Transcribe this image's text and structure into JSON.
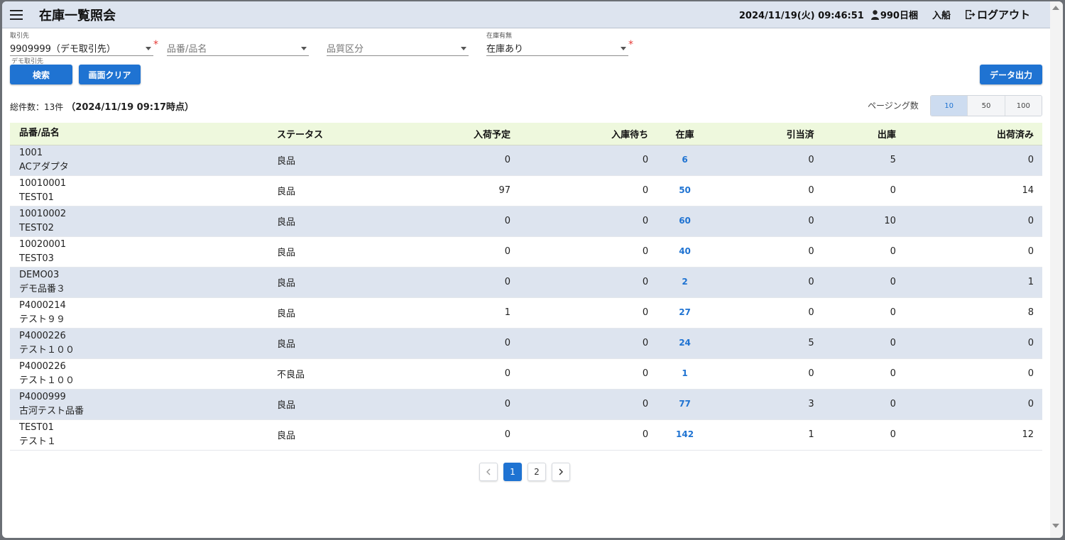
{
  "header": {
    "title": "在庫一覧照会",
    "datetime": "2024/11/19(火) 09:46:51",
    "user": "990日梱",
    "nyusen": "入船",
    "logout": "ログアウト"
  },
  "filters": {
    "torihikisaki": {
      "label": "取引先",
      "value": "9909999（デモ取引先）",
      "helper": "デモ取引先"
    },
    "hinban": {
      "placeholder": "品番/品名"
    },
    "hinshitsu": {
      "placeholder": "品質区分"
    },
    "zaiko_umu": {
      "label": "在庫有無",
      "value": "在庫あり"
    },
    "required_mark": "*"
  },
  "buttons": {
    "search": "検索",
    "clear": "画面クリア",
    "export": "データ出力"
  },
  "summary": {
    "total": "総件数：13件",
    "as_of": "（2024/11/19 09:17時点）"
  },
  "paging": {
    "label": "ページング数",
    "options": [
      "10",
      "50",
      "100"
    ]
  },
  "table": {
    "headers": [
      "品番/品名",
      "ステータス",
      "入荷予定",
      "入庫待ち",
      "在庫",
      "引当済",
      "出庫",
      "出荷済み"
    ],
    "rows": [
      {
        "code": "1001",
        "name": "ACアダプタ",
        "status": "良品",
        "nyuka": "0",
        "nyuko": "0",
        "zaiko": "6",
        "hikiate": "0",
        "shukko": "5",
        "shukka": "0"
      },
      {
        "code": "10010001",
        "name": "TEST01",
        "status": "良品",
        "nyuka": "97",
        "nyuko": "0",
        "zaiko": "50",
        "hikiate": "0",
        "shukko": "0",
        "shukka": "14"
      },
      {
        "code": "10010002",
        "name": "TEST02",
        "status": "良品",
        "nyuka": "0",
        "nyuko": "0",
        "zaiko": "60",
        "hikiate": "0",
        "shukko": "10",
        "shukka": "0"
      },
      {
        "code": "10020001",
        "name": "TEST03",
        "status": "良品",
        "nyuka": "0",
        "nyuko": "0",
        "zaiko": "40",
        "hikiate": "0",
        "shukko": "0",
        "shukka": "0"
      },
      {
        "code": "DEMO03",
        "name": "デモ品番３",
        "status": "良品",
        "nyuka": "0",
        "nyuko": "0",
        "zaiko": "2",
        "hikiate": "0",
        "shukko": "0",
        "shukka": "1"
      },
      {
        "code": "P4000214",
        "name": "テスト９９",
        "status": "良品",
        "nyuka": "1",
        "nyuko": "0",
        "zaiko": "27",
        "hikiate": "0",
        "shukko": "0",
        "shukka": "8"
      },
      {
        "code": "P4000226",
        "name": "テスト１００",
        "status": "良品",
        "nyuka": "0",
        "nyuko": "0",
        "zaiko": "24",
        "hikiate": "5",
        "shukko": "0",
        "shukka": "0"
      },
      {
        "code": "P4000226",
        "name": "テスト１００",
        "status": "不良品",
        "nyuka": "0",
        "nyuko": "0",
        "zaiko": "1",
        "hikiate": "0",
        "shukko": "0",
        "shukka": "0"
      },
      {
        "code": "P4000999",
        "name": "古河テスト品番",
        "status": "良品",
        "nyuka": "0",
        "nyuko": "0",
        "zaiko": "77",
        "hikiate": "3",
        "shukko": "0",
        "shukka": "0"
      },
      {
        "code": "TEST01",
        "name": "テスト１",
        "status": "良品",
        "nyuka": "0",
        "nyuko": "0",
        "zaiko": "142",
        "hikiate": "1",
        "shukko": "0",
        "shukka": "12"
      }
    ]
  },
  "pagination": {
    "pages": [
      "1",
      "2"
    ],
    "current": "1"
  },
  "colors": {
    "primary": "#1f73d2",
    "appbar": "#dde4ef",
    "header_row": "#eef8dd",
    "stripe": "#dde4ef",
    "required": "#e53935"
  }
}
